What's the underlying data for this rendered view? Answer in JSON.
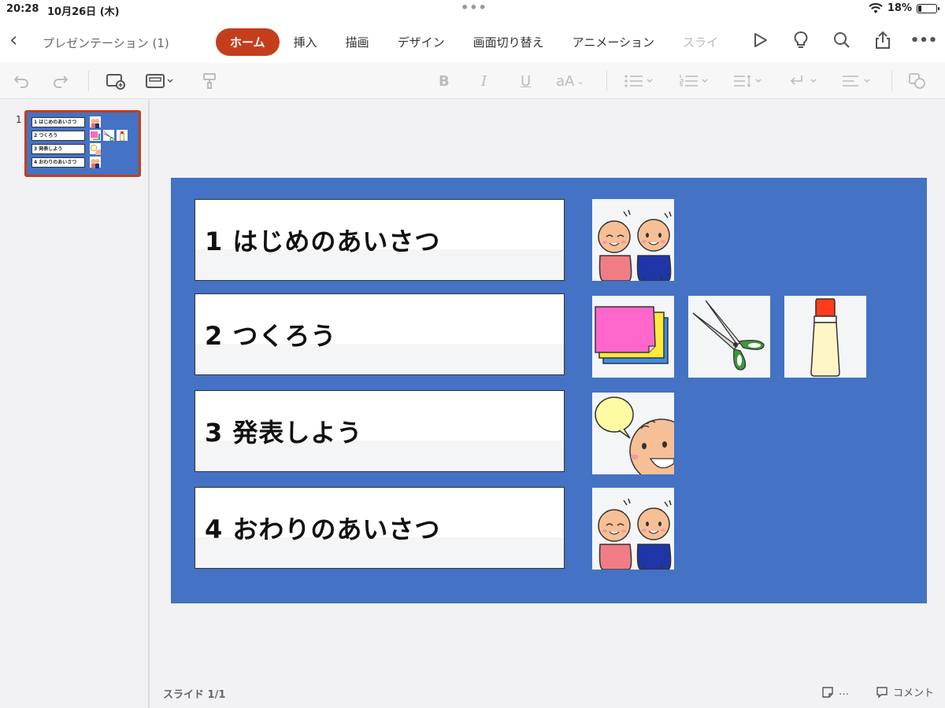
{
  "status": {
    "time": "20:28",
    "date": "10月26日 (木)",
    "battery": "18%",
    "battery_level": 0.18
  },
  "header": {
    "title": "プレゼンテーション (1)",
    "tabs": [
      "ホーム",
      "挿入",
      "描画",
      "デザイン",
      "画面切り替え",
      "アニメーション",
      "スライ"
    ]
  },
  "toolbar": {
    "bold": "B",
    "italic": "I",
    "underline": "U",
    "font_size": "aA"
  },
  "slides_panel": {
    "slide_number": "1"
  },
  "slide": {
    "items": [
      {
        "label": "1 はじめのあいさつ",
        "icons": [
          "greeting-kids-icon"
        ]
      },
      {
        "label": "2 つくろう",
        "icons": [
          "colored-paper-icon",
          "scissors-icon",
          "glue-icon"
        ]
      },
      {
        "label": "3 発表しよう",
        "icons": [
          "speech-bubble-kid-icon"
        ]
      },
      {
        "label": "4 おわりのあいさつ",
        "icons": [
          "greeting-kids-icon"
        ]
      }
    ]
  },
  "footer": {
    "slide_count": "スライド 1/1",
    "notes_label": "…",
    "comments_label": "コメント"
  },
  "colors": {
    "accent": "#c43e1c",
    "slide_background": "#4472c4"
  }
}
